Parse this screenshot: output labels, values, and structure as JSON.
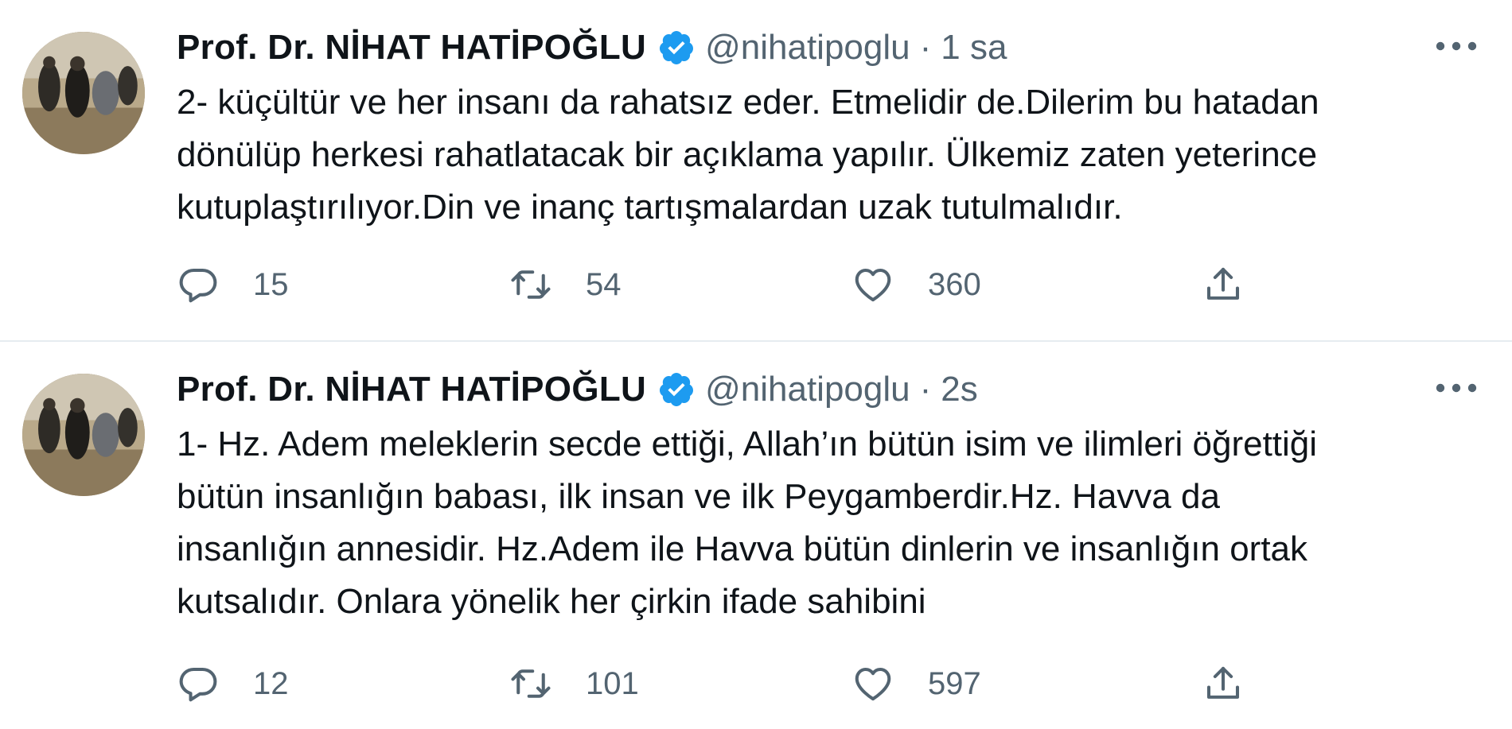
{
  "tweets": [
    {
      "author_name": "Prof. Dr. NİHAT HATİPOĞLU",
      "handle": "@nihatipoglu",
      "separator": "·",
      "time": "1 sa",
      "text": "2- küçültür ve her insanı da rahatsız eder. Etmelidir de.Dilerim bu hatadan\ndönülüp herkesi rahatlatacak bir açıklama yapılır. Ülkemiz zaten yeterince\nkutuplaştırılıyor.Din ve inanç tartışmalardan uzak tutulmalıdır.",
      "reply_count": "15",
      "retweet_count": "54",
      "like_count": "360"
    },
    {
      "author_name": "Prof. Dr. NİHAT HATİPOĞLU",
      "handle": "@nihatipoglu",
      "separator": "·",
      "time": "2s",
      "text": "1- Hz. Adem meleklerin secde ettiği, Allah’ın bütün isim ve ilimleri öğrettiği\nbütün insanlığın babası, ilk insan ve ilk Peygamberdir.Hz. Havva da\ninsanlığın annesidir. Hz.Adem ile Havva bütün dinlerin ve insanlığın ortak\nkutsalıdır. Onlara yönelik her çirkin ifade sahibini",
      "reply_count": "12",
      "retweet_count": "101",
      "like_count": "597"
    }
  ],
  "icons": {
    "verified": "verified-badge-icon",
    "more": "more-options-icon",
    "reply": "reply-icon",
    "retweet": "retweet-icon",
    "like": "heart-icon",
    "share": "share-icon"
  },
  "colors": {
    "verified_blue": "#1d9bf0",
    "text_primary": "#0f1419",
    "text_secondary": "#536471",
    "divider": "#e6ecf0"
  }
}
